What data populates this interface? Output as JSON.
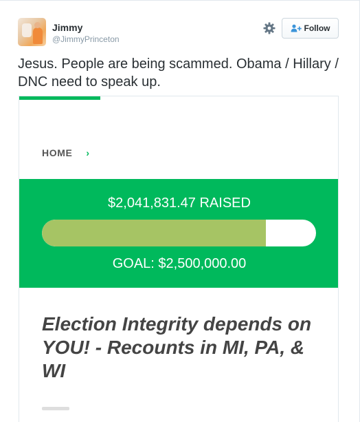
{
  "tweet": {
    "name": "Jimmy",
    "handle": "@JimmyPrinceton",
    "follow_label": "Follow",
    "text": "Jesus. People are being scammed. Obama / Hillary / DNC need to speak up.",
    "icons": {
      "settings": "gear-icon",
      "follow": "add-user-icon"
    }
  },
  "card": {
    "breadcrumb": {
      "label": "HOME",
      "separator": "›"
    },
    "fundraiser": {
      "raised_text": "$2,041,831.47 RAISED",
      "goal_text": "GOAL: $2,500,000.00",
      "progress_fraction": 0.8167
    },
    "headline": "Election Integrity depends on YOU! - Recounts in MI, PA, & WI"
  },
  "colors": {
    "brand_green": "#00b95c",
    "progress_fill": "#a6c464",
    "text_primary": "#292f33",
    "text_muted": "#8899a6"
  }
}
